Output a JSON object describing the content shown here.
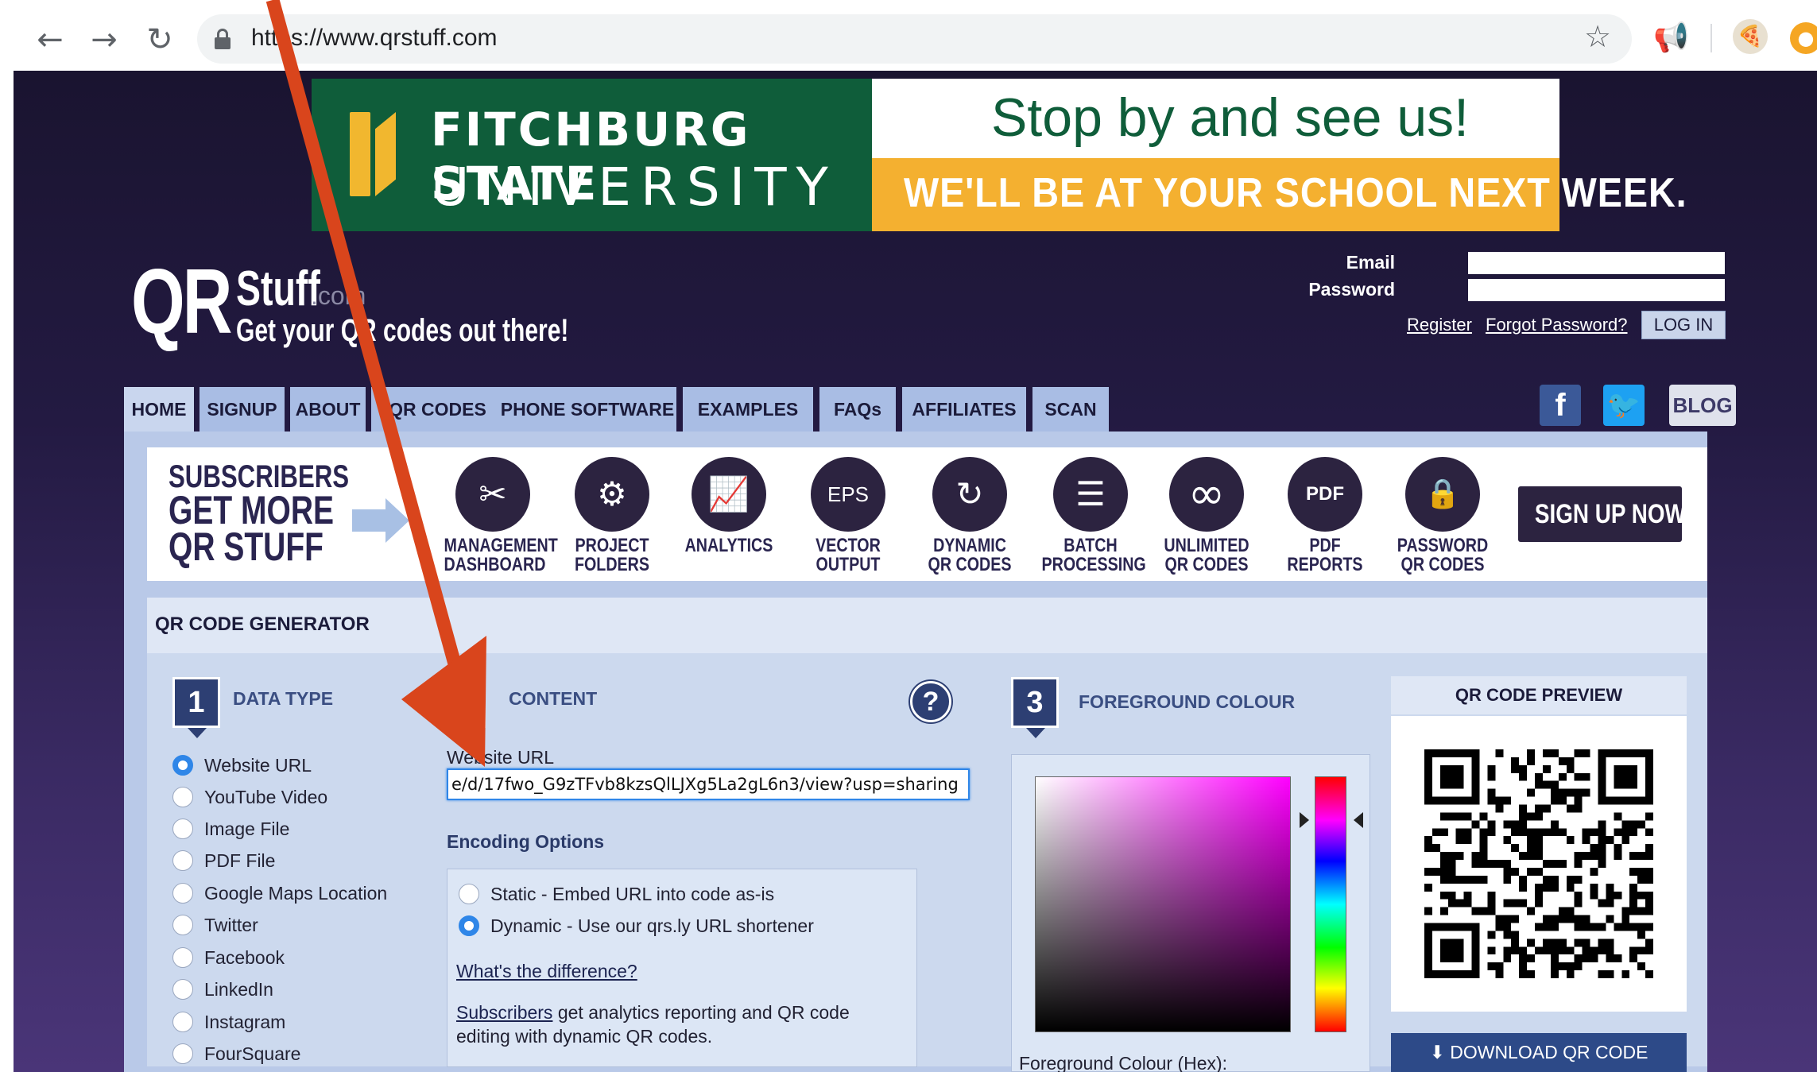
{
  "browser": {
    "url": "https://www.qrstuff.com",
    "back_icon": "arrow-left-icon",
    "forward_icon": "arrow-right-icon",
    "reload_icon": "reload-icon",
    "bookmark_icon": "star-icon"
  },
  "ad": {
    "university_line1": "FITCHBURG STATE",
    "university_line2": "UNIVERSITY",
    "headline": "Stop by and see us!",
    "subline": "WE'LL BE AT YOUR SCHOOL NEXT WEEK.",
    "choices": "▷ ✕"
  },
  "logo": {
    "qr": "QR",
    "stuff": "Stuff",
    "com": ".com",
    "tagline": "Get your QR codes out there!"
  },
  "login": {
    "email_label": "Email",
    "password_label": "Password",
    "register": "Register",
    "forgot": "Forgot Password?",
    "login_button": "LOG IN"
  },
  "nav": {
    "tabs": [
      "HOME",
      "SIGNUP",
      "ABOUT",
      "QR CODES",
      "PHONE SOFTWARE",
      "EXAMPLES",
      "FAQs",
      "AFFILIATES",
      "SCAN"
    ],
    "active": "HOME",
    "blog": "BLOG"
  },
  "subscribers": {
    "line1": "SUBSCRIBERS",
    "line2": "GET MORE",
    "line3": "QR STUFF",
    "features": [
      {
        "label": "MANAGEMENT\nDASHBOARD",
        "icon": "tools-icon",
        "glyph": "✂"
      },
      {
        "label": "PROJECT\nFOLDERS",
        "icon": "gears-icon",
        "glyph": "⚙"
      },
      {
        "label": "ANALYTICS",
        "icon": "chart-icon",
        "glyph": "📈"
      },
      {
        "label": "VECTOR\nOUTPUT",
        "icon": "eps-icon",
        "glyph": "EPS"
      },
      {
        "label": "DYNAMIC\nQR CODES",
        "icon": "refresh-icon",
        "glyph": "↻"
      },
      {
        "label": "BATCH\nPROCESSING",
        "icon": "list-icon",
        "glyph": "☰"
      },
      {
        "label": "UNLIMITED\nQR CODES",
        "icon": "infinity-icon",
        "glyph": "∞"
      },
      {
        "label": "PDF\nREPORTS",
        "icon": "pdf-icon",
        "glyph": "PDF"
      },
      {
        "label": "PASSWORD\nQR CODES",
        "icon": "lock-icon",
        "glyph": "🔒"
      }
    ],
    "signup_button": "SIGN UP NOW"
  },
  "generator": {
    "title": "QR CODE GENERATOR",
    "step1": {
      "number": "1",
      "title": "DATA TYPE"
    },
    "step2": {
      "title": "CONTENT"
    },
    "step3": {
      "number": "3",
      "title": "FOREGROUND COLOUR"
    },
    "data_types": [
      {
        "label": "Website URL",
        "selected": true
      },
      {
        "label": "YouTube Video",
        "selected": false
      },
      {
        "label": "Image File",
        "selected": false
      },
      {
        "label": "PDF File",
        "selected": false
      },
      {
        "label": "Google Maps Location",
        "selected": false
      },
      {
        "label": "Twitter",
        "selected": false
      },
      {
        "label": "Facebook",
        "selected": false
      },
      {
        "label": "LinkedIn",
        "selected": false
      },
      {
        "label": "Instagram",
        "selected": false
      },
      {
        "label": "FourSquare",
        "selected": false
      }
    ],
    "url_label": "Website URL",
    "url_value": "e/d/17fwo_G9zTFvb8kzsQlLJXg5La2gL6n3/view?usp=sharing",
    "encoding_title": "Encoding Options",
    "encoding_options": [
      {
        "label": "Static - Embed URL into code as-is",
        "selected": false
      },
      {
        "label": "Dynamic - Use our qrs.ly URL shortener",
        "selected": true
      }
    ],
    "difference_link": "What's the difference?",
    "subscribers_link": "Subscribers",
    "subscribers_note": " get analytics reporting and QR code editing with dynamic QR codes.",
    "fg_hex_label": "Foreground Colour (Hex):",
    "preview_title": "QR CODE PREVIEW",
    "download_button": "DOWNLOAD QR CODE",
    "help_glyph": "?"
  },
  "colors": {
    "annotation_arrow": "#d9451c",
    "accent_blue": "#2f86e8",
    "step_badge": "#2d3f73"
  }
}
